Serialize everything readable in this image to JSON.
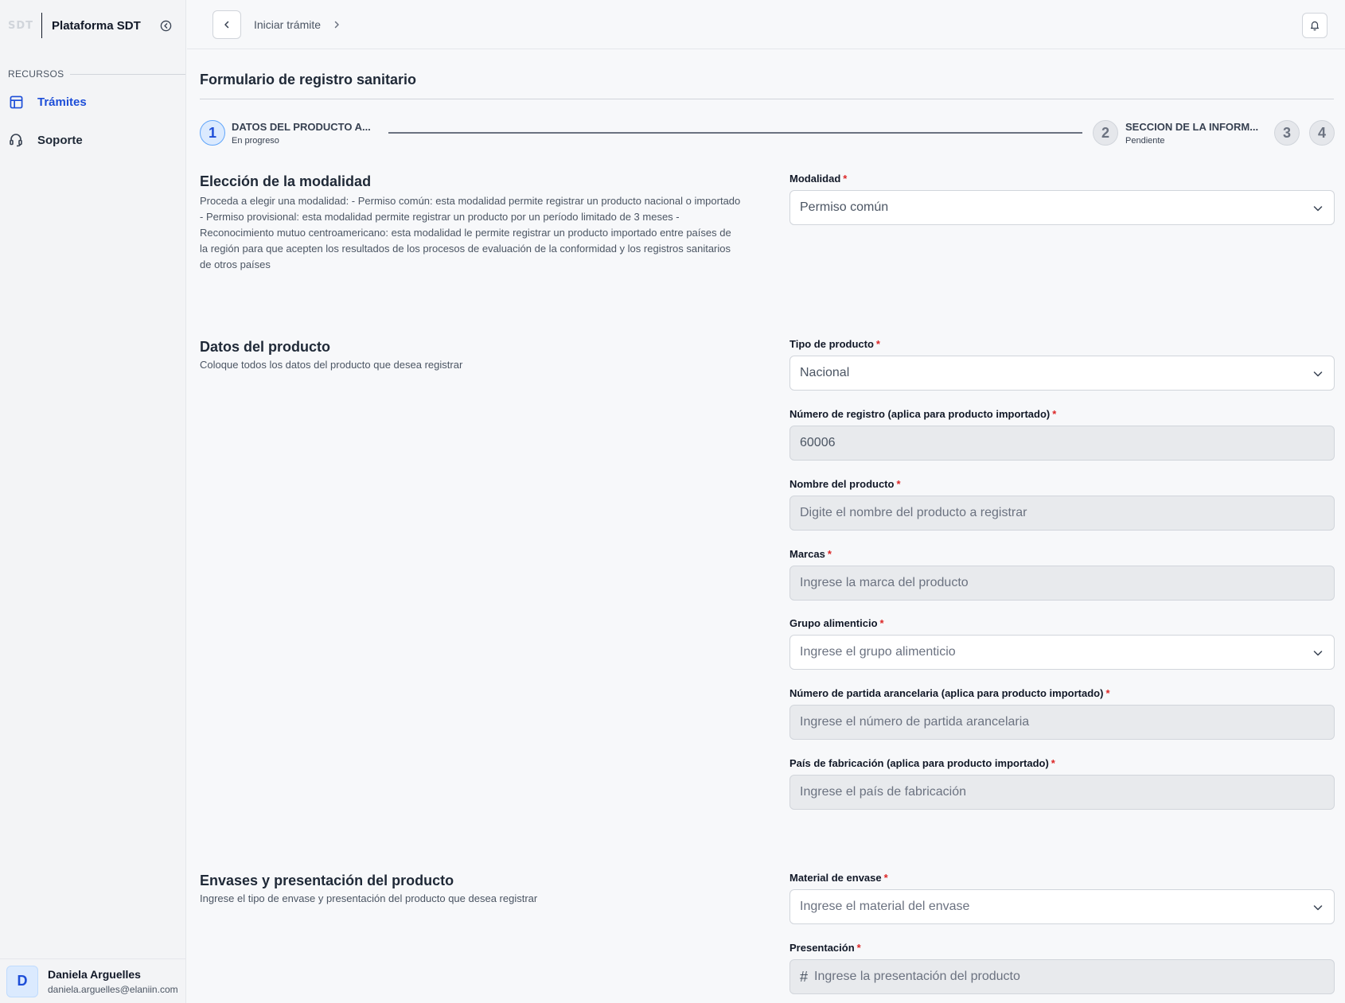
{
  "sidebar": {
    "logo": "SDT",
    "title": "Plataforma SDT",
    "section_label": "RECURSOS",
    "items": [
      {
        "label": "Trámites"
      },
      {
        "label": "Soporte"
      }
    ],
    "user": {
      "initial": "D",
      "name": "Daniela Arguelles",
      "email": "daniela.arguelles@elaniin.com"
    }
  },
  "topbar": {
    "breadcrumb": "Iniciar trámite"
  },
  "page": {
    "title": "Formulario de registro sanitario"
  },
  "stepper": {
    "steps": [
      {
        "number": "1",
        "title": "DATOS DEL PRODUCTO A...",
        "status": "En progreso"
      },
      {
        "number": "2",
        "title": "SECCION DE LA INFORM...",
        "status": "Pendiente"
      },
      {
        "number": "3"
      },
      {
        "number": "4"
      }
    ]
  },
  "sections": {
    "modalidad": {
      "title": "Elección de la modalidad",
      "description": "Proceda a elegir una modalidad: - Permiso común: esta modalidad permite registrar un producto nacional o importado - Permiso provisional: esta modalidad permite registrar un producto por un período limitado de 3 meses - Reconocimiento mutuo centroamericano: esta modalidad le permite registrar un producto importado entre países de la región para que acepten los resultados de los procesos de evaluación de la conformidad y los registros sanitarios de otros países"
    },
    "producto": {
      "title": "Datos del producto",
      "description": "Coloque todos los datos del producto que desea registrar"
    },
    "envases": {
      "title": "Envases y presentación del producto",
      "description": "Ingrese el tipo de envase y presentación del producto que desea registrar"
    }
  },
  "fields": {
    "modalidad": {
      "label": "Modalidad",
      "required": "*",
      "value": "Permiso común"
    },
    "tipo_producto": {
      "label": "Tipo de producto",
      "required": "*",
      "value": "Nacional"
    },
    "numero_registro": {
      "label": "Número de registro (aplica para producto importado)",
      "required": "*",
      "value": "60006"
    },
    "nombre_producto": {
      "label": "Nombre del producto",
      "required": "*",
      "placeholder": "Digite el nombre del producto a registrar"
    },
    "marcas": {
      "label": "Marcas",
      "required": "*",
      "placeholder": "Ingrese la marca del producto"
    },
    "grupo_alimenticio": {
      "label": "Grupo alimenticio",
      "required": "*",
      "placeholder": "Ingrese el grupo alimenticio"
    },
    "partida_arancelaria": {
      "label": "Número de partida arancelaria (aplica para producto importado)",
      "required": "*",
      "placeholder": "Ingrese el número de partida arancelaria"
    },
    "pais_fabricacion": {
      "label": "País de fabricación (aplica para producto importado)",
      "required": "*",
      "placeholder": "Ingrese el país de fabricación"
    },
    "material_envase": {
      "label": "Material de envase",
      "required": "*",
      "placeholder": "Ingrese el material del envase"
    },
    "presentacion": {
      "label": "Presentación",
      "required": "*",
      "placeholder": "Ingrese la presentación del producto"
    }
  },
  "colors": {
    "accent": "#1d4ed8",
    "required": "#dc2626"
  }
}
